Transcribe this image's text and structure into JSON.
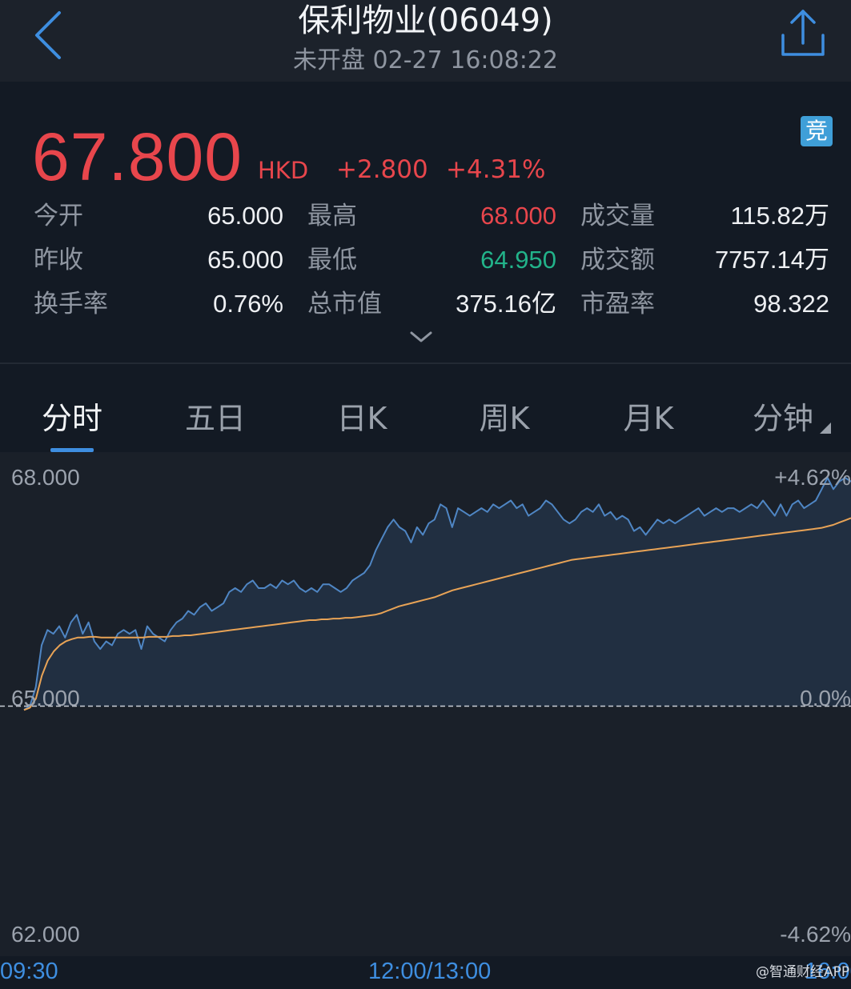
{
  "header": {
    "title": "保利物业(06049)",
    "status": "未开盘 02-27 16:08:22"
  },
  "quote": {
    "price": "67.800",
    "currency": "HKD",
    "change": "+2.800",
    "change_pct": "+4.31%",
    "auction_badge": "竞",
    "stats": [
      {
        "label": "今开",
        "value": "65.000",
        "tone": "neutral"
      },
      {
        "label": "最高",
        "value": "68.000",
        "tone": "up"
      },
      {
        "label": "成交量",
        "value": "115.82万",
        "tone": "neutral"
      },
      {
        "label": "昨收",
        "value": "65.000",
        "tone": "neutral"
      },
      {
        "label": "最低",
        "value": "64.950",
        "tone": "down"
      },
      {
        "label": "成交额",
        "value": "7757.14万",
        "tone": "neutral"
      },
      {
        "label": "换手率",
        "value": "0.76%",
        "tone": "neutral"
      },
      {
        "label": "总市值",
        "value": "375.16亿",
        "tone": "neutral"
      },
      {
        "label": "市盈率",
        "value": "98.322",
        "tone": "neutral"
      }
    ],
    "colors": {
      "up": "#e8464c",
      "down": "#22b38a",
      "accent": "#3e8ee0"
    }
  },
  "tabs": [
    {
      "label": "分时",
      "active": true
    },
    {
      "label": "五日",
      "active": false
    },
    {
      "label": "日K",
      "active": false
    },
    {
      "label": "周K",
      "active": false
    },
    {
      "label": "月K",
      "active": false
    },
    {
      "label": "分钟",
      "active": false
    }
  ],
  "chart_data": {
    "type": "line",
    "y_left_ticks": [
      "68.000",
      "65.000",
      "62.000"
    ],
    "y_right_ticks": [
      "+4.62%",
      "0.0%",
      "-4.62%"
    ],
    "x_ticks": [
      "09:30",
      "12:00/13:00",
      "16:00"
    ],
    "ylim": [
      62.0,
      68.0
    ],
    "prev_close": 65.0,
    "series": [
      {
        "role": "price",
        "color": "#4f86c4",
        "values": [
          64.95,
          65.0,
          65.25,
          65.8,
          66.0,
          65.95,
          66.05,
          65.9,
          66.1,
          66.2,
          65.95,
          66.1,
          65.85,
          65.75,
          65.85,
          65.8,
          65.95,
          66.0,
          65.95,
          66.0,
          65.75,
          66.05,
          65.95,
          65.9,
          65.85,
          66.0,
          66.1,
          66.15,
          66.25,
          66.2,
          66.3,
          66.35,
          66.25,
          66.3,
          66.35,
          66.5,
          66.55,
          66.5,
          66.6,
          66.65,
          66.55,
          66.55,
          66.6,
          66.55,
          66.65,
          66.6,
          66.65,
          66.55,
          66.5,
          66.55,
          66.5,
          66.6,
          66.6,
          66.55,
          66.5,
          66.55,
          66.65,
          66.7,
          66.75,
          66.85,
          67.05,
          67.2,
          67.35,
          67.45,
          67.35,
          67.3,
          67.15,
          67.35,
          67.25,
          67.4,
          67.45,
          67.65,
          67.6,
          67.35,
          67.6,
          67.55,
          67.5,
          67.55,
          67.6,
          67.55,
          67.65,
          67.6,
          67.65,
          67.7,
          67.6,
          67.65,
          67.5,
          67.55,
          67.6,
          67.7,
          67.65,
          67.55,
          67.45,
          67.4,
          67.45,
          67.55,
          67.6,
          67.55,
          67.65,
          67.5,
          67.55,
          67.45,
          67.5,
          67.45,
          67.3,
          67.35,
          67.25,
          67.35,
          67.45,
          67.4,
          67.45,
          67.4,
          67.45,
          67.5,
          67.55,
          67.6,
          67.5,
          67.55,
          67.6,
          67.55,
          67.6,
          67.6,
          67.55,
          67.6,
          67.65,
          67.6,
          67.7,
          67.6,
          67.5,
          67.65,
          67.5,
          67.65,
          67.7,
          67.6,
          67.65,
          67.7,
          67.85,
          68.0,
          67.85,
          67.95,
          68.0,
          67.95
        ],
        "note": ""
      },
      {
        "role": "average",
        "color": "#e8a356",
        "values": [
          64.95,
          64.98,
          65.1,
          65.4,
          65.6,
          65.72,
          65.8,
          65.85,
          65.88,
          65.9,
          65.9,
          65.91,
          65.91,
          65.9,
          65.9,
          65.9,
          65.9,
          65.9,
          65.9,
          65.9,
          65.9,
          65.91,
          65.91,
          65.91,
          65.91,
          65.92,
          65.92,
          65.93,
          65.93,
          65.94,
          65.95,
          65.96,
          65.97,
          65.98,
          65.99,
          66.0,
          66.01,
          66.02,
          66.03,
          66.04,
          66.05,
          66.06,
          66.07,
          66.08,
          66.09,
          66.1,
          66.11,
          66.12,
          66.13,
          66.13,
          66.14,
          66.14,
          66.15,
          66.15,
          66.16,
          66.16,
          66.17,
          66.18,
          66.19,
          66.2,
          66.22,
          66.25,
          66.28,
          66.31,
          66.33,
          66.35,
          66.37,
          66.39,
          66.41,
          66.43,
          66.46,
          66.49,
          66.52,
          66.54,
          66.56,
          66.58,
          66.6,
          66.62,
          66.64,
          66.66,
          66.68,
          66.7,
          66.72,
          66.74,
          66.76,
          66.78,
          66.8,
          66.82,
          66.84,
          66.86,
          66.88,
          66.9,
          66.92,
          66.93,
          66.94,
          66.95,
          66.96,
          66.97,
          66.98,
          66.99,
          67.0,
          67.01,
          67.02,
          67.03,
          67.04,
          67.05,
          67.06,
          67.07,
          67.08,
          67.09,
          67.1,
          67.11,
          67.12,
          67.13,
          67.14,
          67.15,
          67.16,
          67.17,
          67.18,
          67.19,
          67.2,
          67.21,
          67.22,
          67.23,
          67.24,
          67.25,
          67.26,
          67.27,
          67.28,
          67.29,
          67.3,
          67.31,
          67.32,
          67.33,
          67.34,
          67.36,
          67.38,
          67.41,
          67.44,
          67.47
        ]
      }
    ]
  },
  "watermark": "@智通财经APP"
}
